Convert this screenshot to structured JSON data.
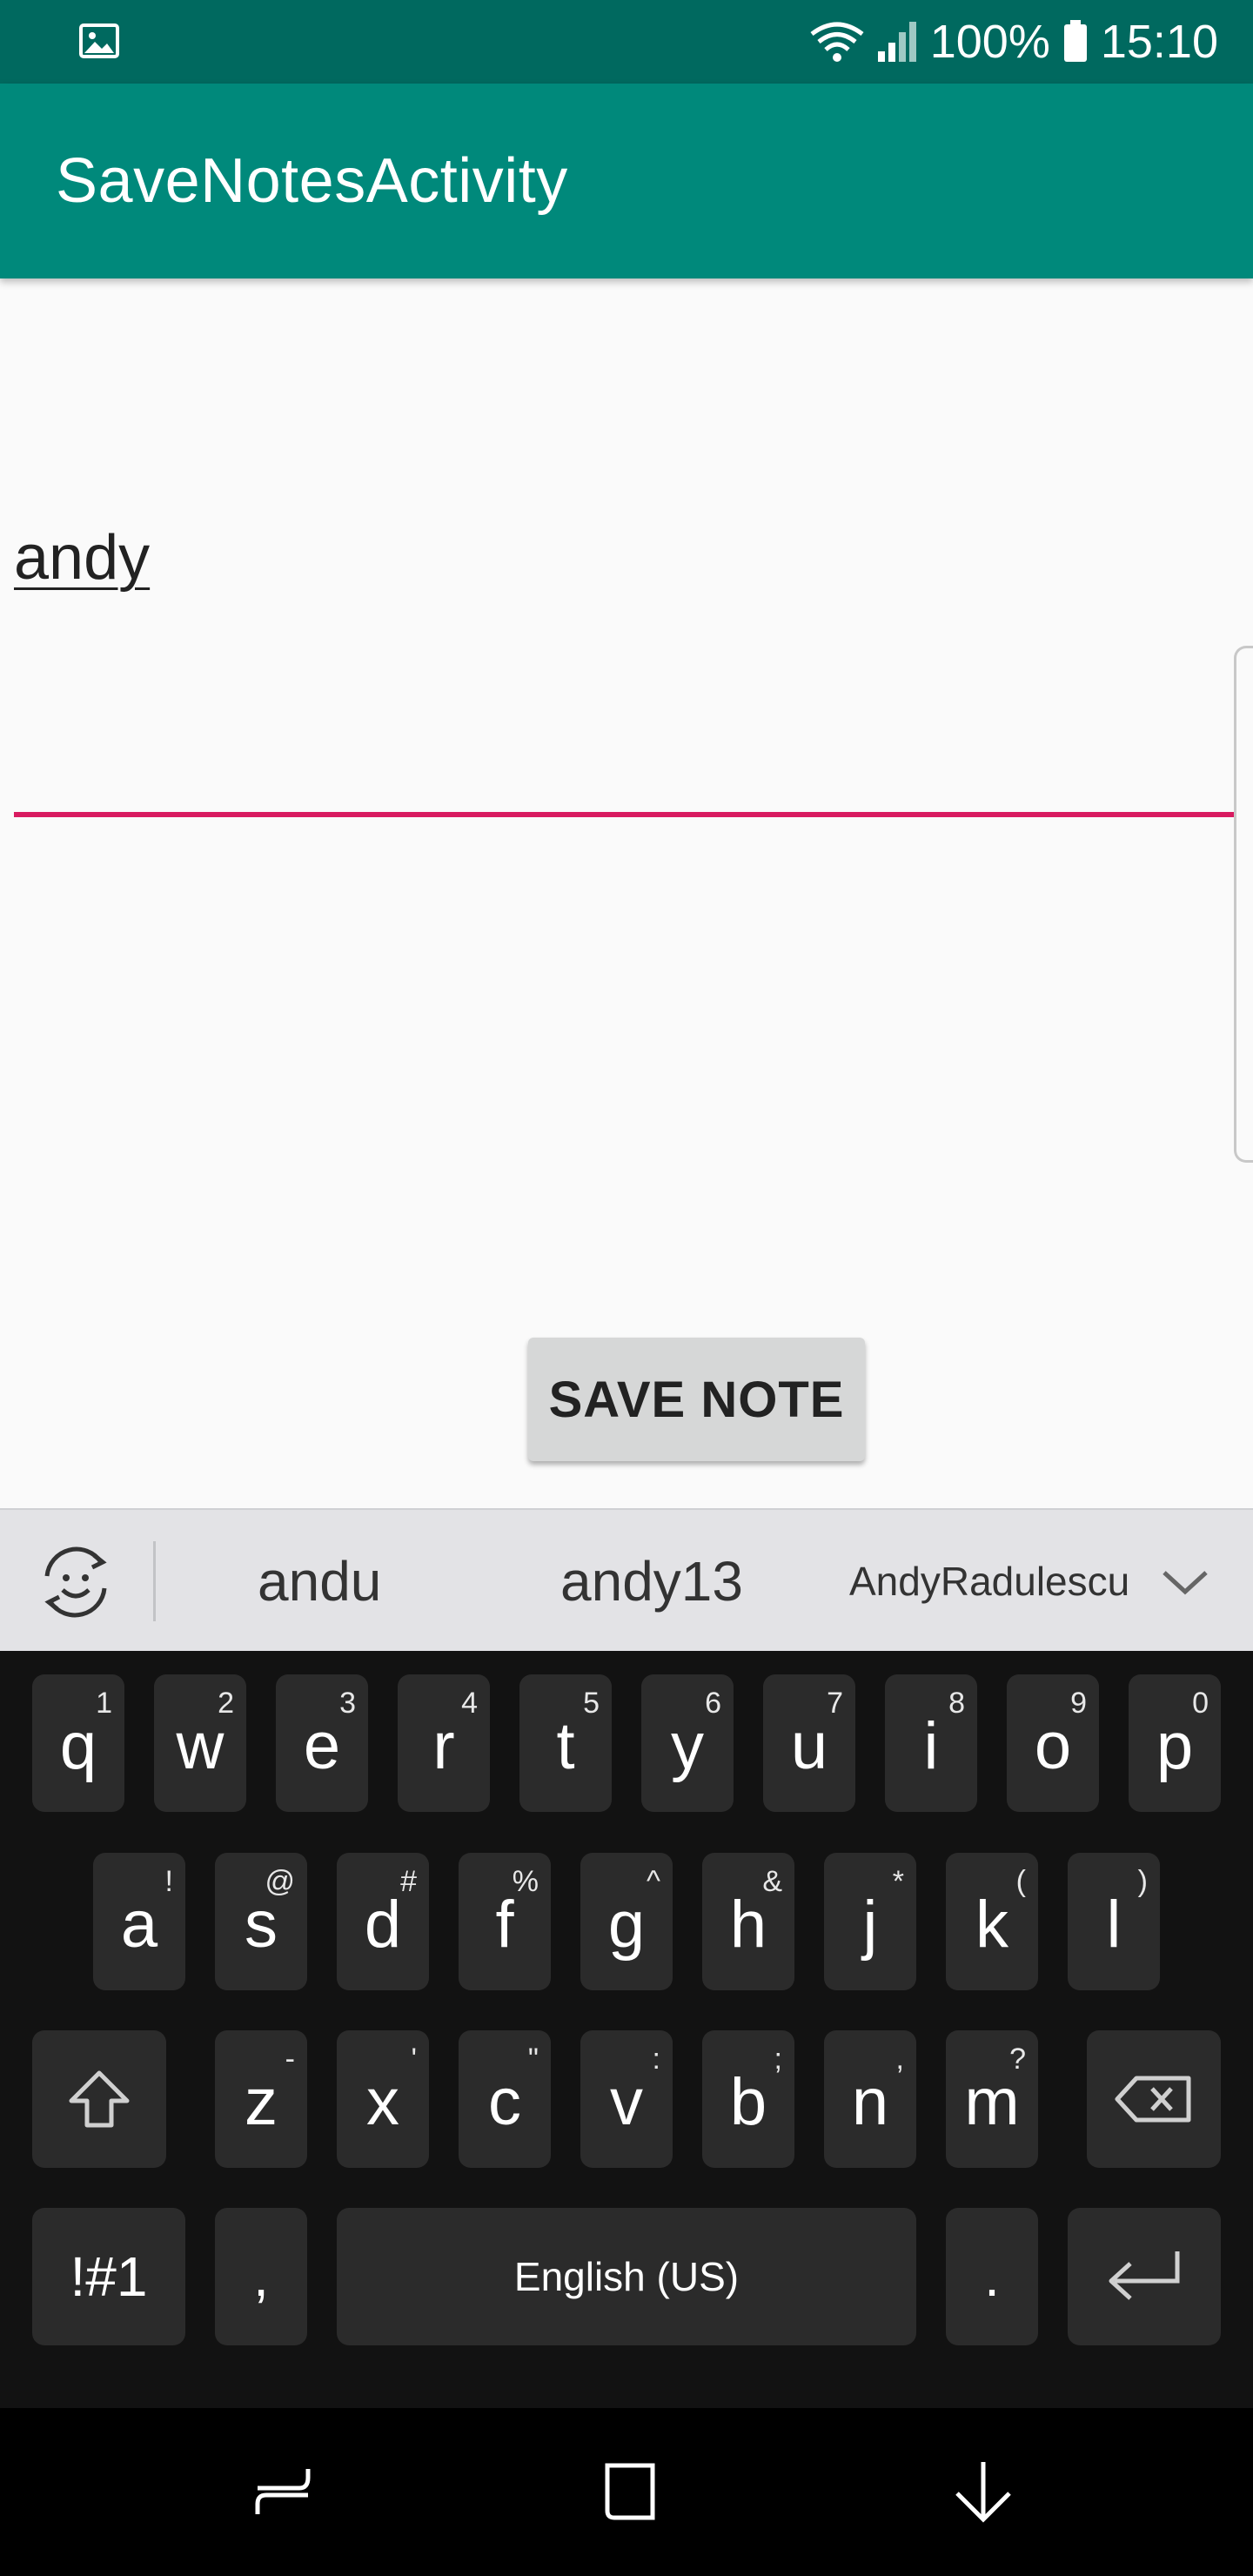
{
  "status_bar": {
    "battery": "100%",
    "time": "15:10",
    "icons": [
      "image-icon",
      "wifi-icon",
      "signal-icon",
      "battery-icon"
    ]
  },
  "app_bar": {
    "title": "SaveNotesActivity"
  },
  "editor": {
    "value": "andy"
  },
  "save_button": {
    "label": "SAVE NOTE"
  },
  "suggestions": {
    "items": [
      "andu",
      "andy13",
      "AndyRadulescu"
    ]
  },
  "keyboard": {
    "row1": [
      {
        "key": "q",
        "sup": "1"
      },
      {
        "key": "w",
        "sup": "2"
      },
      {
        "key": "e",
        "sup": "3"
      },
      {
        "key": "r",
        "sup": "4"
      },
      {
        "key": "t",
        "sup": "5"
      },
      {
        "key": "y",
        "sup": "6"
      },
      {
        "key": "u",
        "sup": "7"
      },
      {
        "key": "i",
        "sup": "8"
      },
      {
        "key": "o",
        "sup": "9"
      },
      {
        "key": "p",
        "sup": "0"
      }
    ],
    "row2": [
      {
        "key": "a",
        "sup": "!"
      },
      {
        "key": "s",
        "sup": "@"
      },
      {
        "key": "d",
        "sup": "#"
      },
      {
        "key": "f",
        "sup": "%"
      },
      {
        "key": "g",
        "sup": "^"
      },
      {
        "key": "h",
        "sup": "&"
      },
      {
        "key": "j",
        "sup": "*"
      },
      {
        "key": "k",
        "sup": "("
      },
      {
        "key": "l",
        "sup": ")"
      }
    ],
    "row3": [
      {
        "key": "z",
        "sup": "-"
      },
      {
        "key": "x",
        "sup": "'"
      },
      {
        "key": "c",
        "sup": "\""
      },
      {
        "key": "v",
        "sup": ":"
      },
      {
        "key": "b",
        "sup": ";"
      },
      {
        "key": "n",
        "sup": ","
      },
      {
        "key": "m",
        "sup": "?"
      }
    ],
    "symbols_label": "!#1",
    "comma_label": ",",
    "space_label": "English (US)",
    "period_label": "."
  },
  "colors": {
    "status_bar": "#00695f",
    "app_bar": "#00897b",
    "accent": "#d81b60"
  }
}
